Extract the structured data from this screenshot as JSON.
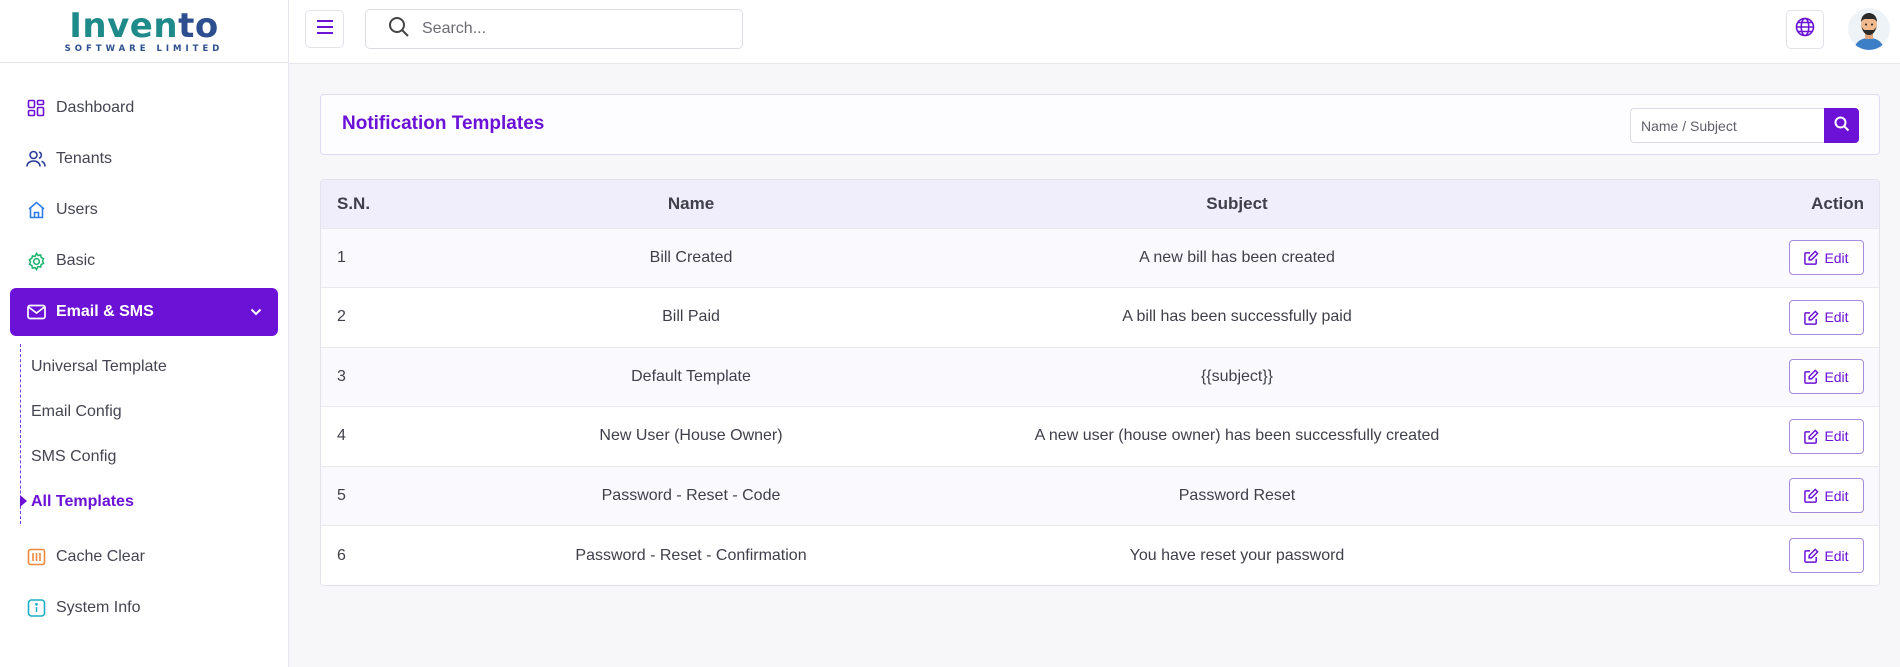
{
  "brand": {
    "name_part1": "Inven",
    "name_part2": "to",
    "subtitle": "SOFTWARE LIMITED"
  },
  "search": {
    "placeholder": "Search..."
  },
  "sidebar": {
    "items": [
      {
        "label": "Dashboard",
        "icon": "dashboard-icon"
      },
      {
        "label": "Tenants",
        "icon": "users-icon"
      },
      {
        "label": "Users",
        "icon": "home-icon"
      },
      {
        "label": "Basic",
        "icon": "gear-icon"
      },
      {
        "label": "Email & SMS",
        "icon": "mail-icon"
      },
      {
        "label": "Cache Clear",
        "icon": "cache-icon"
      },
      {
        "label": "System Info",
        "icon": "info-icon"
      }
    ],
    "submenu": [
      {
        "label": "Universal Template"
      },
      {
        "label": "Email Config"
      },
      {
        "label": "SMS Config"
      },
      {
        "label": "All Templates"
      }
    ]
  },
  "main": {
    "title": "Notification Templates",
    "filter_placeholder": "Name / Subject"
  },
  "table": {
    "headers": {
      "sn": "S.N.",
      "name": "Name",
      "subject": "Subject",
      "action": "Action"
    },
    "edit_label": "Edit",
    "rows": [
      {
        "sn": "1",
        "name": "Bill Created",
        "subject": "A new bill has been created"
      },
      {
        "sn": "2",
        "name": "Bill Paid",
        "subject": "A bill has been successfully paid"
      },
      {
        "sn": "3",
        "name": "Default Template",
        "subject": "{{subject}}"
      },
      {
        "sn": "4",
        "name": "New User (House Owner)",
        "subject": "A new user (house owner) has been successfully created"
      },
      {
        "sn": "5",
        "name": "Password - Reset - Code",
        "subject": "Password Reset"
      },
      {
        "sn": "6",
        "name": "Password - Reset - Confirmation",
        "subject": "You have reset your password"
      }
    ]
  },
  "colors": {
    "accent": "#6b12d6",
    "brand_teal": "#1f8a8a",
    "brand_navy": "#2d4f8f"
  }
}
